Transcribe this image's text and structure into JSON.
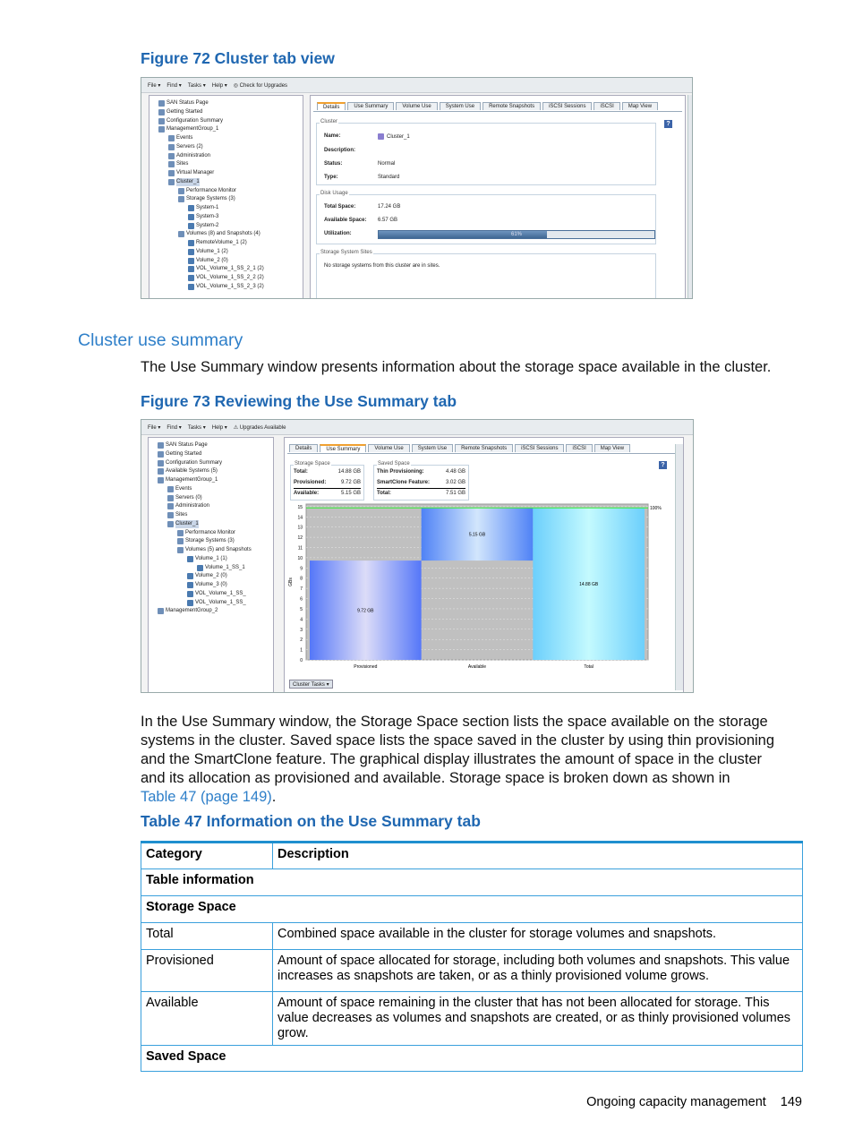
{
  "figure72": {
    "title": "Figure 72 Cluster tab view",
    "menu": [
      "File ▾",
      "Find ▾",
      "Tasks ▾",
      "Help ▾",
      "◎ Check for Upgrades"
    ],
    "tree": [
      {
        "label": "SAN Status Page",
        "level": 0,
        "icon": "home-icon"
      },
      {
        "label": "Getting Started",
        "level": 0,
        "icon": "arrow-icon"
      },
      {
        "label": "Configuration Summary",
        "level": 0,
        "icon": "sigma-icon"
      },
      {
        "label": "ManagementGroup_1",
        "level": 0,
        "icon": "group-icon"
      },
      {
        "label": "Events",
        "level": 1,
        "icon": "events-icon"
      },
      {
        "label": "Servers (2)",
        "level": 1,
        "icon": "server-icon"
      },
      {
        "label": "Administration",
        "level": 1,
        "icon": "admin-icon"
      },
      {
        "label": "Sites",
        "level": 1,
        "icon": "globe-icon"
      },
      {
        "label": "Virtual Manager",
        "level": 1,
        "icon": "plus-icon"
      },
      {
        "label": "Cluster_1",
        "level": 1,
        "icon": "cluster-icon",
        "selected": true
      },
      {
        "label": "Performance Monitor",
        "level": 2,
        "icon": "monitor-icon"
      },
      {
        "label": "Storage Systems (3)",
        "level": 2,
        "icon": "storage-icon"
      },
      {
        "label": "System-1",
        "level": 3,
        "icon": "system-icon"
      },
      {
        "label": "System-3",
        "level": 3,
        "icon": "system-icon"
      },
      {
        "label": "System-2",
        "level": 3,
        "icon": "system-icon"
      },
      {
        "label": "Volumes (8) and Snapshots (4)",
        "level": 2,
        "icon": "volumes-icon"
      },
      {
        "label": "RemoteVolume_1 (2)",
        "level": 3,
        "icon": "volume-icon"
      },
      {
        "label": "Volume_1 (2)",
        "level": 3,
        "icon": "volume-icon"
      },
      {
        "label": "Volume_2 (0)",
        "level": 3,
        "icon": "volume-icon"
      },
      {
        "label": "VOL_Volume_1_SS_2_1 (2)",
        "level": 3,
        "icon": "volume-icon"
      },
      {
        "label": "VOL_Volume_1_SS_2_2 (2)",
        "level": 3,
        "icon": "volume-icon"
      },
      {
        "label": "VOL_Volume_1_SS_2_3 (2)",
        "level": 3,
        "icon": "volume-icon"
      }
    ],
    "tabs": [
      "Details",
      "Use Summary",
      "Volume Use",
      "System Use",
      "Remote Snapshots",
      "iSCSI Sessions",
      "iSCSI",
      "Map View"
    ],
    "active_tab": "Details",
    "cluster": {
      "legend": "Cluster",
      "name_label": "Name:",
      "name": "Cluster_1",
      "description_label": "Description:",
      "status_label": "Status:",
      "status": "Normal",
      "type_label": "Type:",
      "type": "Standard"
    },
    "disk_usage": {
      "legend": "Disk Usage",
      "total_label": "Total Space:",
      "total": "17.24 GB",
      "available_label": "Available Space:",
      "available": "6.57 GB",
      "utilization_label": "Utilization:",
      "utilization_text": "61%",
      "utilization": 61
    },
    "sites": {
      "legend": "Storage System Sites",
      "message": "No storage systems from this cluster are in sites."
    },
    "help": "?"
  },
  "section": {
    "heading": "Cluster use summary",
    "intro": "The Use Summary window presents information about the storage space available in the cluster."
  },
  "figure73": {
    "title": "Figure 73 Reviewing the Use Summary tab",
    "menu": [
      "File ▾",
      "Find ▾",
      "Tasks ▾",
      "Help ▾",
      "⚠ Upgrades Available"
    ],
    "tree": [
      {
        "label": "SAN Status Page",
        "level": 0
      },
      {
        "label": "Getting Started",
        "level": 0
      },
      {
        "label": "Configuration Summary",
        "level": 0
      },
      {
        "label": "Available Systems (5)",
        "level": 0
      },
      {
        "label": "ManagementGroup_1",
        "level": 0
      },
      {
        "label": "Events",
        "level": 1
      },
      {
        "label": "Servers (0)",
        "level": 1
      },
      {
        "label": "Administration",
        "level": 1
      },
      {
        "label": "Sites",
        "level": 1
      },
      {
        "label": "Cluster_1",
        "level": 1,
        "selected": true
      },
      {
        "label": "Performance Monitor",
        "level": 2
      },
      {
        "label": "Storage Systems (3)",
        "level": 2
      },
      {
        "label": "Volumes (5) and Snapshots",
        "level": 2
      },
      {
        "label": "Volume_1 (1)",
        "level": 3
      },
      {
        "label": "Volume_1_SS_1",
        "level": 4
      },
      {
        "label": "Volume_2 (0)",
        "level": 3
      },
      {
        "label": "Volume_3 (0)",
        "level": 3
      },
      {
        "label": "VOL_Volume_1_SS_",
        "level": 3
      },
      {
        "label": "VOL_Volume_1_SS_",
        "level": 3
      },
      {
        "label": "ManagementGroup_2",
        "level": 0
      }
    ],
    "tabs": [
      "Details",
      "Use Summary",
      "Volume Use",
      "System Use",
      "Remote Snapshots",
      "iSCSI Sessions",
      "iSCSI",
      "Map View"
    ],
    "active_tab": "Use Summary",
    "storage_space": {
      "legend": "Storage Space",
      "total_label": "Total:",
      "total": "14.88 GB",
      "provisioned_label": "Provisioned:",
      "provisioned": "9.72 GB",
      "available_label": "Available:",
      "available": "5.15 GB"
    },
    "saved_space": {
      "legend": "Saved Space",
      "thin_label": "Thin Provisioning:",
      "thin": "4.48 GB",
      "smartclone_label": "SmartClone Feature:",
      "smartclone": "3.02 GB",
      "total_label": "Total:",
      "total": "7.51 GB"
    },
    "cluster_tasks": "Cluster Tasks ▾",
    "help": "?"
  },
  "chart_data": {
    "type": "bar",
    "categories": [
      "Provisioned",
      "Available",
      "Total"
    ],
    "series": [
      {
        "base": [
          0,
          9.72,
          0
        ],
        "values": [
          9.72,
          14.88,
          14.88
        ]
      }
    ],
    "data_labels": [
      "9.72 GB",
      "5.15 GB",
      "14.88 GB"
    ],
    "ylabel": "GBs",
    "ylim": [
      0,
      15.25
    ],
    "yticks": [
      0,
      1,
      2,
      3,
      4,
      5,
      6,
      7,
      8,
      9,
      10,
      11,
      12,
      13,
      14,
      15
    ],
    "reference_line": {
      "value": 14.88,
      "label": "100%",
      "color": "#33ee33"
    },
    "grid": true,
    "colors": [
      "#5b7cf5",
      "#5a8af5",
      "#6cd0fb"
    ]
  },
  "paragraph": [
    "In the Use Summary window, the Storage Space section lists the space available on the storage",
    "systems in the cluster. Saved space lists the space saved in the cluster by using thin provisioning",
    "and the SmartClone feature. The graphical display illustrates the amount of space in the cluster",
    "and its allocation as provisioned and available. Storage space is broken down as shown in"
  ],
  "paragraph_link": "Table 47 (page 149)",
  "paragraph_end": ".",
  "table47": {
    "title": "Table 47 Information on the Use Summary tab",
    "headers": [
      "Category",
      "Description"
    ],
    "rows": [
      {
        "type": "section",
        "label": "Table information"
      },
      {
        "type": "section",
        "label": "Storage Space"
      },
      {
        "category": "Total",
        "description": "Combined space available in the cluster for storage volumes and snapshots."
      },
      {
        "category": "Provisioned",
        "description": "Amount of space allocated for storage, including both volumes and snapshots. This value increases as snapshots are taken, or as a thinly provisioned volume grows."
      },
      {
        "category": "Available",
        "description": "Amount of space remaining in the cluster that has not been allocated for storage. This value decreases as volumes and snapshots are created, or as thinly provisioned volumes grow."
      },
      {
        "type": "section",
        "label": "Saved Space"
      }
    ]
  },
  "footer": {
    "section": "Ongoing capacity management",
    "page": "149"
  }
}
